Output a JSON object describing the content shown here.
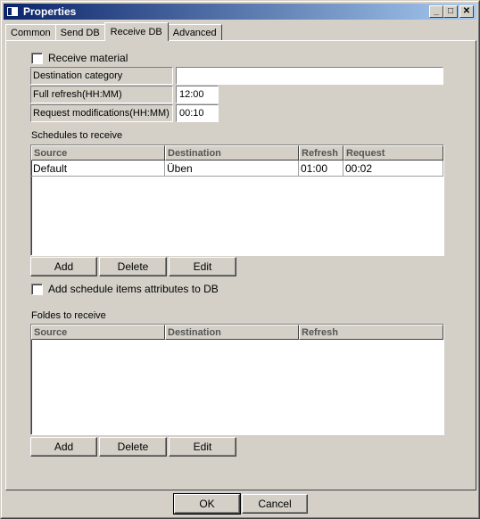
{
  "window": {
    "title": "Properties"
  },
  "titlebar": {
    "minimize": "_",
    "maximize": "□",
    "close": "✕"
  },
  "tabs": [
    {
      "label": "Common"
    },
    {
      "label": "Send DB"
    },
    {
      "label": "Receive DB",
      "active": true
    },
    {
      "label": "Advanced"
    }
  ],
  "receive_material": {
    "label": "Receive material",
    "checked": false
  },
  "form": {
    "destination_category": {
      "label": "Destination category",
      "value": ""
    },
    "full_refresh": {
      "label": "Full refresh(HH:MM)",
      "value": "12:00"
    },
    "request_modifications": {
      "label": "Request modifications(HH:MM)",
      "value": "00:10"
    }
  },
  "schedules": {
    "title": "Schedules to receive",
    "columns": [
      "Source",
      "Destination",
      "Refresh",
      "Request"
    ],
    "rows": [
      {
        "source": "Default",
        "destination": "Üben",
        "refresh": "01:00",
        "request": "00:02"
      }
    ],
    "add_label": "Add",
    "delete_label": "Delete",
    "edit_label": "Edit"
  },
  "add_schedule_attrs": {
    "label": "Add schedule items attributes to DB",
    "checked": false
  },
  "foldes": {
    "title": "Foldes to receive",
    "columns": [
      "Source",
      "Destination",
      "Refresh"
    ],
    "add_label": "Add",
    "delete_label": "Delete",
    "edit_label": "Edit"
  },
  "footer": {
    "ok_label": "OK",
    "cancel_label": "Cancel"
  }
}
